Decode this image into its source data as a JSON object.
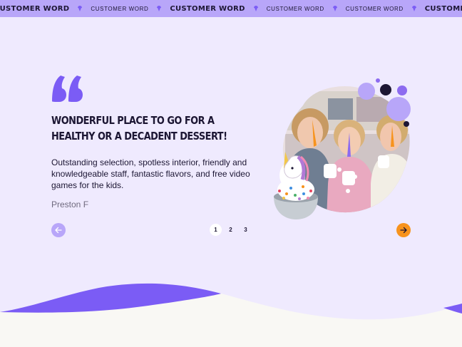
{
  "ticker": {
    "items": [
      {
        "text": "CUSTOMER WORD",
        "style": "bold"
      },
      {
        "text": "CUSTOMER WORD",
        "style": "light"
      },
      {
        "text": "CUSTOMER WORD",
        "style": "bold"
      },
      {
        "text": "CUSTOMER WORD",
        "style": "light"
      },
      {
        "text": "CUSTOMER WORD",
        "style": "light"
      },
      {
        "text": "CUSTOMER WORD",
        "style": "bold"
      }
    ],
    "separator_icon": "ice-cream-icon"
  },
  "testimonial": {
    "quote_icon": "quote-icon",
    "headline": "WONDERFUL PLACE TO GO FOR A HEALTHY OR A DECADENT DESSERT!",
    "body": "Outstanding selection, spotless interior, friendly and knowledgeable staff, fantastic flavors, and free video games for the kids.",
    "author": "Preston F"
  },
  "pagination": {
    "pages": [
      "1",
      "2",
      "3"
    ],
    "active": "1",
    "prev_icon": "arrow-left-icon",
    "next_icon": "arrow-right-icon"
  },
  "colors": {
    "accent_purple": "#7b5cf5",
    "light_purple": "#b8a6f9",
    "background": "#efeafe",
    "orange": "#f7931d",
    "dark": "#1c1633"
  }
}
